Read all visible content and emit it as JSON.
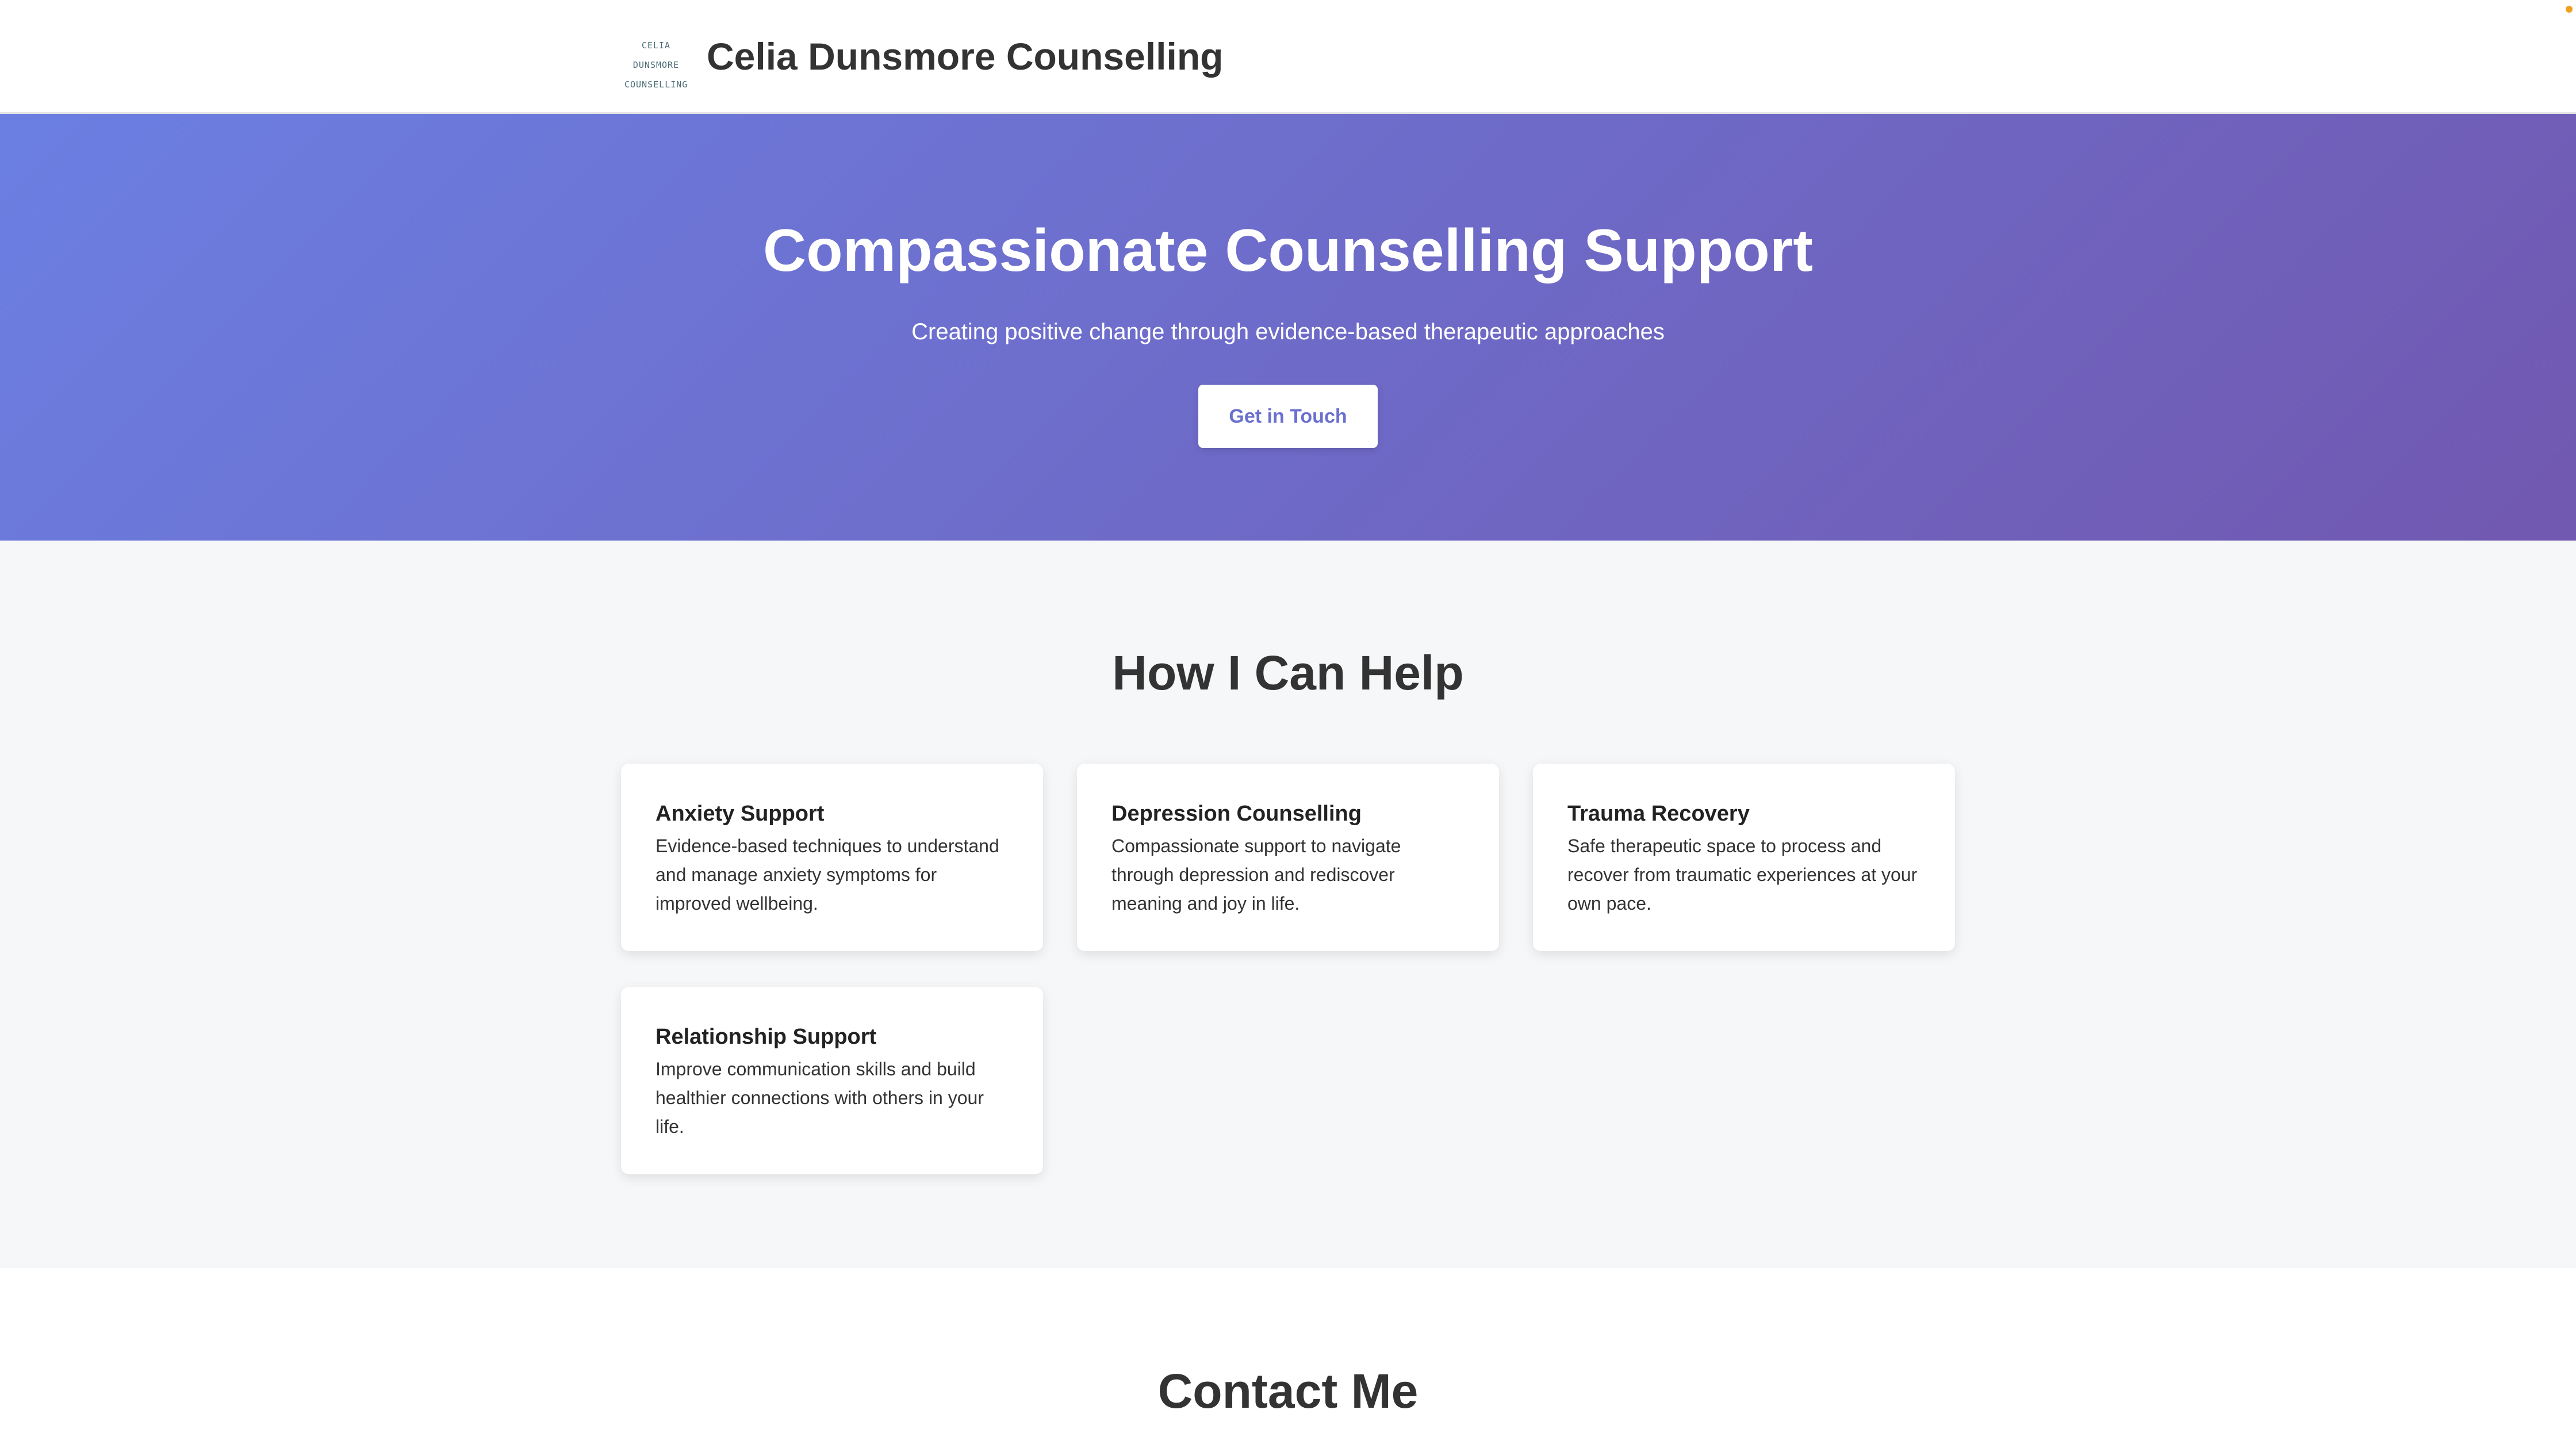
{
  "header": {
    "logo_text_line1": "CELIA DUNSMORE",
    "logo_text_line2": "COUNSELLING",
    "site_title": "Celia Dunsmore Counselling"
  },
  "hero": {
    "title": "Compassionate Counselling Support",
    "subtitle": "Creating positive change through evidence-based therapeutic approaches",
    "cta_label": "Get in Touch",
    "gradient_start": "#6b7fe2",
    "gradient_end": "#7158b0"
  },
  "services": {
    "heading": "How I Can Help",
    "cards": [
      {
        "title": "Anxiety Support",
        "text": "Evidence-based techniques to understand and manage anxiety symptoms for improved wellbeing."
      },
      {
        "title": "Depression Counselling",
        "text": "Compassionate support to navigate through depression and rediscover meaning and joy in life."
      },
      {
        "title": "Trauma Recovery",
        "text": "Safe therapeutic space to process and recover from traumatic experiences at your own pace."
      },
      {
        "title": "Relationship Support",
        "text": "Improve communication skills and build healthier connections with others in your life."
      }
    ]
  },
  "contact": {
    "heading": "Contact Me"
  }
}
